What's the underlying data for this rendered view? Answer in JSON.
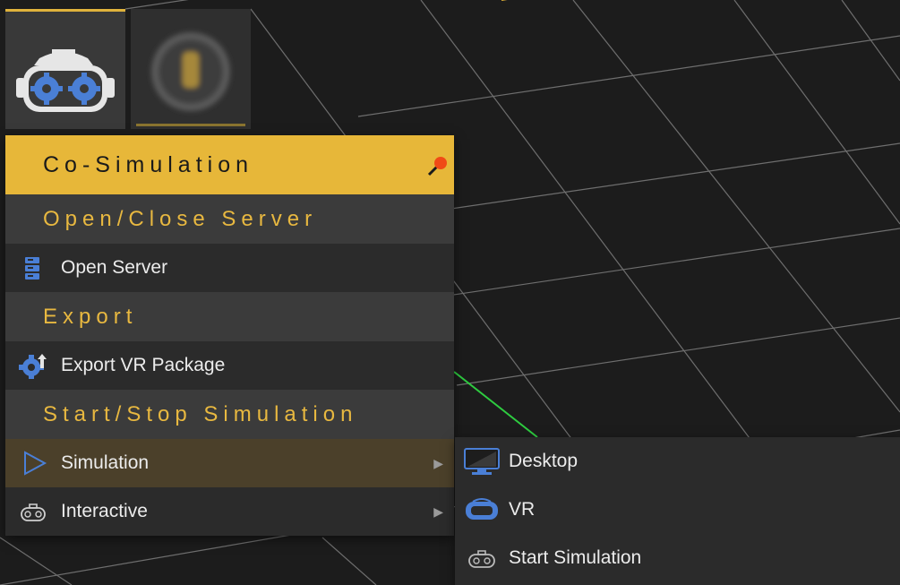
{
  "toolbar": {
    "buttons": [
      {
        "name": "co-simulation",
        "icon": "vr-headset-gear-icon",
        "active": true
      },
      {
        "name": "other-tool",
        "icon": "blurred-tool-icon",
        "active": false
      }
    ]
  },
  "menu": {
    "title": "Co-Simulation",
    "pin_icon": "pin-icon",
    "sections": [
      {
        "label": "Open/Close Server"
      },
      {
        "label": "Export"
      },
      {
        "label": "Start/Stop Simulation"
      }
    ],
    "items": {
      "open_server": {
        "label": "Open Server",
        "icon": "server-icon"
      },
      "export_vr": {
        "label": "Export VR Package",
        "icon": "gear-export-icon"
      },
      "simulation": {
        "label": "Simulation",
        "icon": "play-icon",
        "arrow": "▶"
      },
      "interactive": {
        "label": "Interactive",
        "icon": "gamepad-icon",
        "arrow": "▶"
      }
    }
  },
  "submenu": {
    "items": [
      {
        "label": "Desktop",
        "icon": "monitor-icon"
      },
      {
        "label": "VR",
        "icon": "vr-headset-icon"
      },
      {
        "label": "Start Simulation",
        "icon": "gamepad-icon"
      }
    ]
  },
  "colors": {
    "accent": "#e7b739",
    "section_text": "#e8b840",
    "menu_bg": "#2b2b2b",
    "section_bg": "#3b3b3b",
    "active_bg": "#4b402a",
    "icon_blue": "#4a7fd6",
    "viewport_bg": "#1c1c1c"
  }
}
